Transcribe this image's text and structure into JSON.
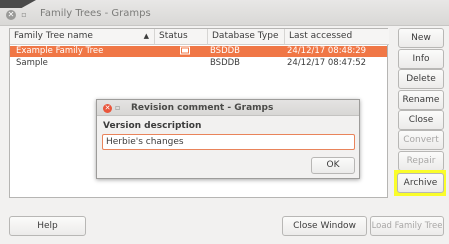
{
  "window": {
    "title": "Family Trees - Gramps",
    "close_icon": "close-icon",
    "minimize_icon": "minimize-icon"
  },
  "tree": {
    "columns": [
      "Family Tree name",
      "Status",
      "Database Type",
      "Last accessed"
    ],
    "sort_icon": "sort-ascending-icon",
    "rows": [
      {
        "name": "Example Family Tree",
        "status_icon": "open-tree-icon",
        "type": "BSDDB",
        "accessed": "24/12/17 08:48:29",
        "selected": true
      },
      {
        "name": "Sample",
        "status_icon": "",
        "type": "BSDDB",
        "accessed": "24/12/17 08:47:52",
        "selected": false
      }
    ]
  },
  "buttons": {
    "new": "New",
    "info": "Info",
    "delete": "Delete",
    "rename": "Rename",
    "close": "Close",
    "convert": "Convert",
    "repair": "Repair",
    "archive": "Archive",
    "help": "Help",
    "close_window": "Close Window",
    "load_family_tree": "Load Family Tree"
  },
  "dialog": {
    "title": "Revision comment - Gramps",
    "label": "Version description",
    "input_value": "Herbie's changes",
    "ok": "OK"
  },
  "colors": {
    "selection": "#f07746",
    "highlight": "#fafd2a",
    "dialog_close": "#e9553b"
  }
}
